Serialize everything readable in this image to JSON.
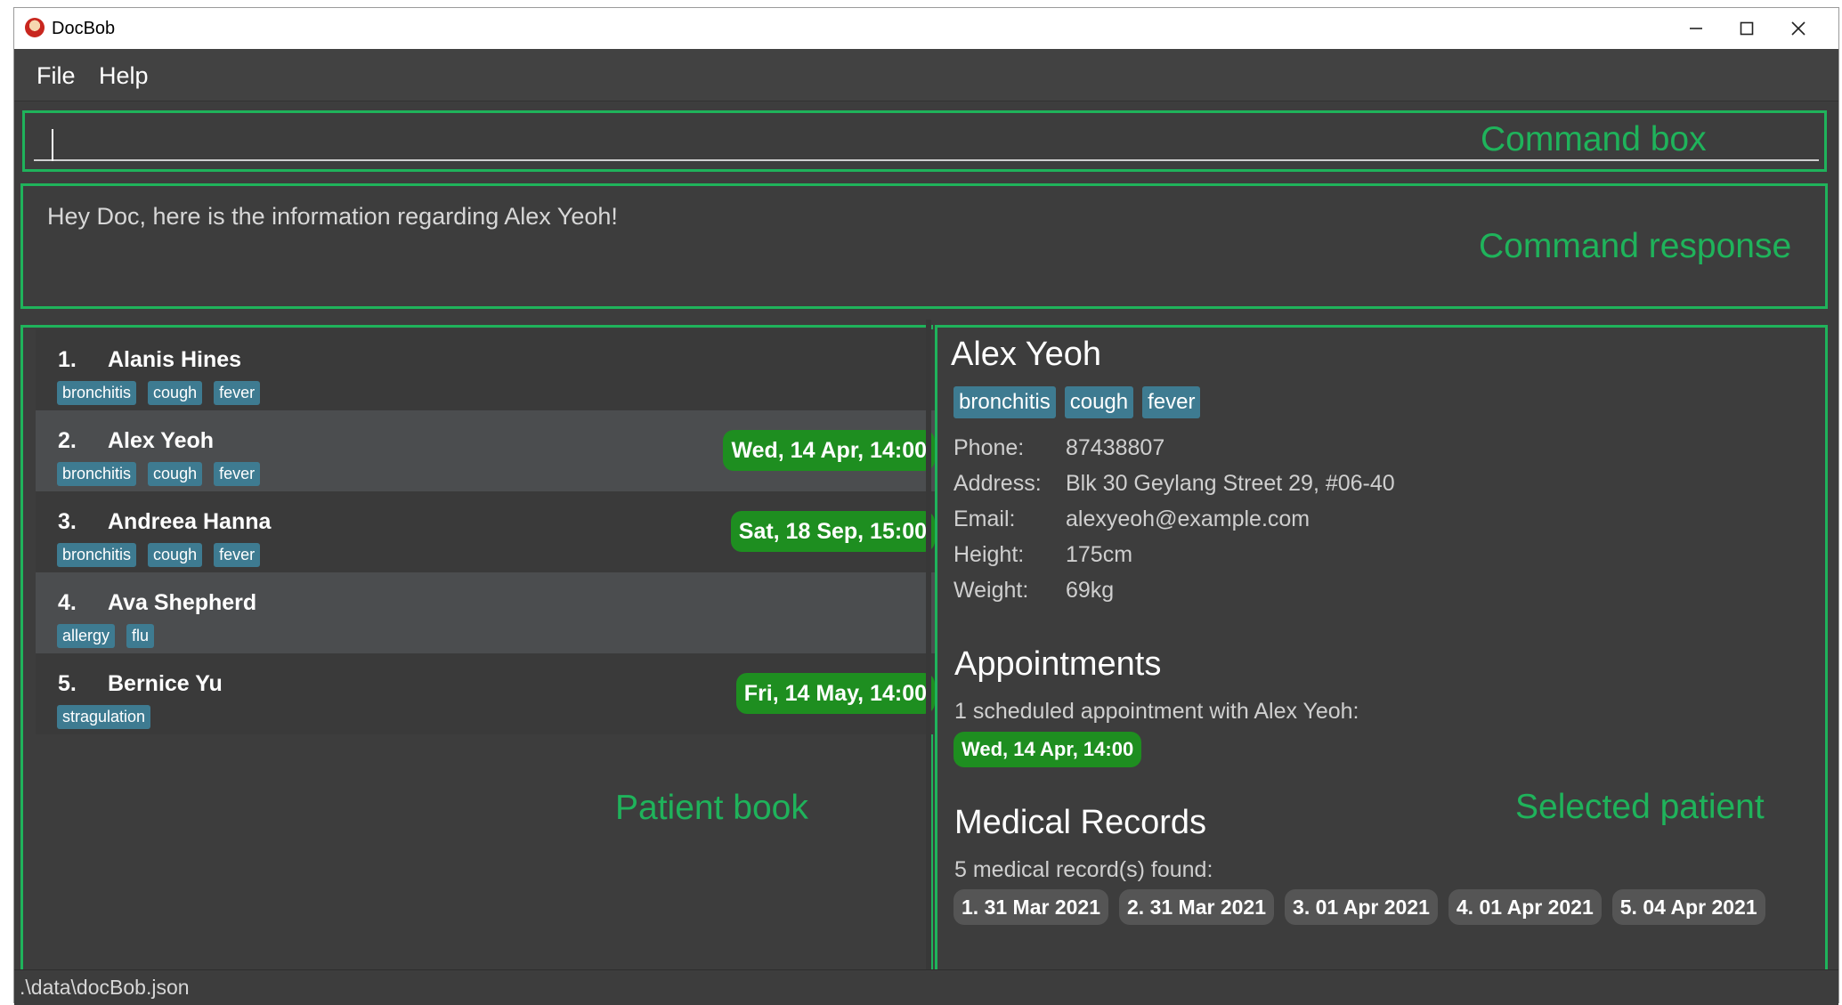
{
  "window": {
    "title": "DocBob",
    "icons": {
      "app": "docbob-app-icon",
      "minimize": "minimize-icon",
      "maximize": "maximize-icon",
      "close": "close-icon"
    }
  },
  "menu": {
    "file": "File",
    "help": "Help"
  },
  "annotations": {
    "command_box": "Command box",
    "command_response": "Command response",
    "patient_book": "Patient book",
    "selected_patient": "Selected patient",
    "color": "#1fb35b"
  },
  "command": {
    "value": "",
    "placeholder": ""
  },
  "response": {
    "text": "Hey Doc, here is the information regarding Alex Yeoh!"
  },
  "patients": [
    {
      "index": "1.",
      "name": "Alanis Hines",
      "tags": [
        "bronchitis",
        "cough",
        "fever"
      ],
      "appointment": ""
    },
    {
      "index": "2.",
      "name": "Alex Yeoh",
      "tags": [
        "bronchitis",
        "cough",
        "fever"
      ],
      "appointment": "Wed, 14 Apr, 14:00"
    },
    {
      "index": "3.",
      "name": "Andreea Hanna",
      "tags": [
        "bronchitis",
        "cough",
        "fever"
      ],
      "appointment": "Sat, 18 Sep, 15:00"
    },
    {
      "index": "4.",
      "name": "Ava Shepherd",
      "tags": [
        "allergy",
        "flu"
      ],
      "appointment": ""
    },
    {
      "index": "5.",
      "name": "Bernice Yu",
      "tags": [
        "stragulation"
      ],
      "appointment": "Fri, 14 May, 14:00"
    }
  ],
  "selected": {
    "name": "Alex Yeoh",
    "tags": [
      "bronchitis",
      "cough",
      "fever"
    ],
    "fields": [
      {
        "label": "Phone:",
        "value": "87438807"
      },
      {
        "label": "Address:",
        "value": "Blk 30 Geylang Street 29, #06-40"
      },
      {
        "label": "Email:",
        "value": "alexyeoh@example.com"
      },
      {
        "label": "Height:",
        "value": "175cm"
      },
      {
        "label": "Weight:",
        "value": "69kg"
      }
    ],
    "appointments_title": "Appointments",
    "appointments_summary": "1 scheduled appointment with Alex Yeoh:",
    "appointments": [
      "Wed, 14 Apr, 14:00"
    ],
    "records_title": "Medical Records",
    "records_summary": "5 medical record(s) found:",
    "records": [
      "1. 31 Mar 2021",
      "2. 31 Mar 2021",
      "3. 01 Apr 2021",
      "4. 01 Apr 2021",
      "5. 04 Apr 2021"
    ]
  },
  "status": {
    "path": ".\\data\\docBob.json"
  },
  "colors": {
    "tag": "#3e7b91",
    "appointment": "#1e8e20",
    "record": "#555555",
    "background": "#3d3d3d"
  }
}
